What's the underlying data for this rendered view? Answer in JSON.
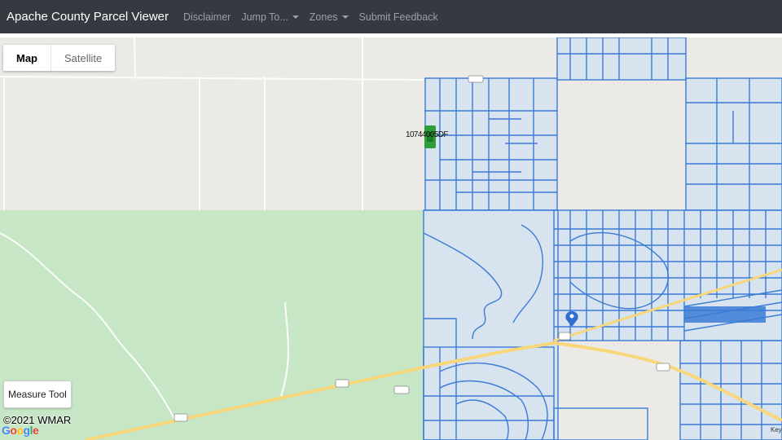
{
  "header": {
    "title": "Apache County Parcel Viewer",
    "nav": [
      {
        "label": "Disclaimer",
        "dropdown": false
      },
      {
        "label": "Jump To...",
        "dropdown": true
      },
      {
        "label": "Zones",
        "dropdown": true
      },
      {
        "label": "Submit Feedback",
        "dropdown": false
      }
    ]
  },
  "map": {
    "type_control": {
      "map_label": "Map",
      "satellite_label": "Satellite",
      "selected": "Map"
    },
    "measure_tool_label": "Measure Tool",
    "copyright": "©2021 WMAR",
    "parcel_label": "10744005DF",
    "corner_text": "Key",
    "colors": {
      "parcel": "#3a7bd5",
      "parcel_fill": "#d7e3ef",
      "park": "#c7e6c6",
      "highway": "#f8d77a",
      "marker_green": "#2e9e3a"
    }
  }
}
